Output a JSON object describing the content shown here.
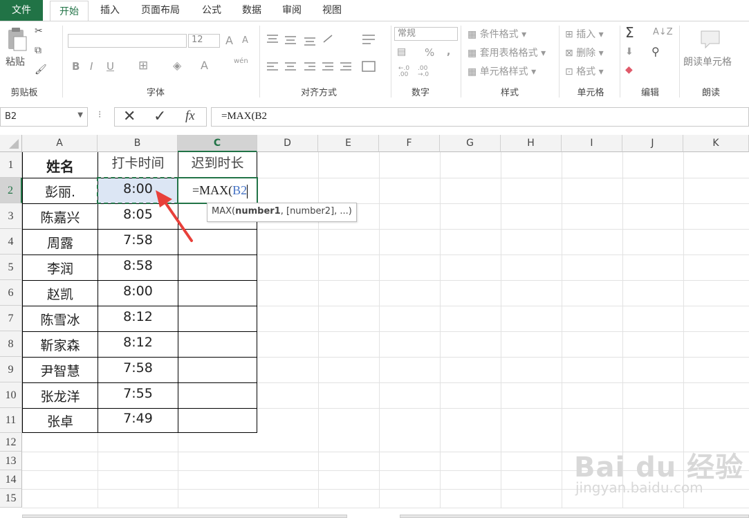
{
  "tabs": [
    "文件",
    "开始",
    "插入",
    "页面布局",
    "公式",
    "数据",
    "审阅",
    "视图"
  ],
  "ribbon": {
    "clipboard": {
      "paste": "粘贴",
      "group": "剪贴板"
    },
    "font": {
      "size": "12",
      "bold": "B",
      "italic": "I",
      "underline": "U",
      "group": "字体",
      "grow": "A",
      "shrink": "A",
      "font_color": "A",
      "phonetic": "wén"
    },
    "alignment": {
      "group": "对齐方式"
    },
    "number": {
      "format": "常规",
      "percent": "%",
      "comma": ",",
      "inc_decimal": "←.0\n.00",
      "dec_decimal": ".00\n→.0",
      "group": "数字"
    },
    "styles": {
      "conditional": "条件格式",
      "table": "套用表格格式",
      "cell_styles": "单元格样式",
      "group": "样式"
    },
    "cells": {
      "insert": "插入",
      "delete": "删除",
      "format": "格式",
      "group": "单元格"
    },
    "editing": {
      "sum": "Σ",
      "group": "编辑"
    },
    "read": {
      "read_cell": "朗读单元格",
      "group": "朗读"
    }
  },
  "formula_bar": {
    "name_box": "B2",
    "formula": "=MAX(B2",
    "fx": "fx"
  },
  "columns": [
    "A",
    "B",
    "C",
    "D",
    "E",
    "F",
    "G",
    "H",
    "I",
    "J",
    "K"
  ],
  "rows": [
    "1",
    "2",
    "3",
    "4",
    "5",
    "6",
    "7",
    "8",
    "9",
    "10",
    "11",
    "12",
    "13",
    "14",
    "15"
  ],
  "headers": {
    "name": "姓名",
    "time": "打卡时间",
    "late": "迟到时长"
  },
  "data": [
    {
      "name": "彭丽.",
      "time": "8:00"
    },
    {
      "name": "陈嘉兴",
      "time": "8:05"
    },
    {
      "name": "周露",
      "time": "7:58"
    },
    {
      "name": "李润",
      "time": "8:58"
    },
    {
      "name": "赵凯",
      "time": "8:00"
    },
    {
      "name": "陈雪冰",
      "time": "8:12"
    },
    {
      "name": "靳家森",
      "time": "8:12"
    },
    {
      "name": "尹智慧",
      "time": "7:58"
    },
    {
      "name": "张龙洋",
      "time": "7:55"
    },
    {
      "name": "张卓",
      "time": "7:49"
    }
  ],
  "editing_cell": {
    "prefix": "=MAX(",
    "ref": "B2"
  },
  "tooltip": {
    "fn": "MAX(",
    "arg1": "number1",
    "rest": ", [number2], ...)"
  },
  "watermark": {
    "brand": "Bai du 经验",
    "url": "jingyan.baidu.com"
  },
  "colors": {
    "excel_green": "#217346",
    "ref_blue": "#4472c4",
    "arrow_red": "#e8403a"
  }
}
